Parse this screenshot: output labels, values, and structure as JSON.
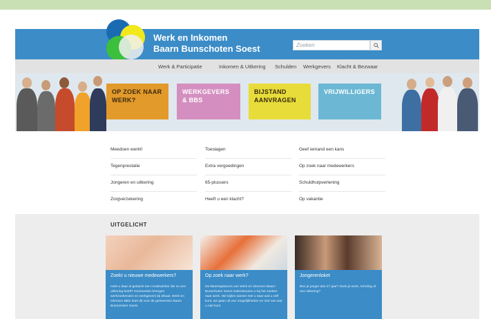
{
  "brand": {
    "line1": "Werk en Inkomen",
    "line2": "Baarn Bunschoten Soest"
  },
  "search": {
    "placeholder": "Zoeken",
    "icon": "magnifier-icon"
  },
  "nav": [
    "Werk & Participatie",
    "Inkomen & Uitkering",
    "Schulden",
    "Werkgevers",
    "Klacht & Bezwaar"
  ],
  "tiles": [
    {
      "label": "OP ZOEK NAAR WERK?",
      "color": "#e29a2a"
    },
    {
      "label": "WERKGEVERS & BBS",
      "color": "#d48fc0"
    },
    {
      "label": "BIJSTAND AANVRAGEN",
      "color": "#e8dc3a"
    },
    {
      "label": "VRIJWILLIGERS",
      "color": "#6cb8d4"
    }
  ],
  "links": [
    [
      "Meedoen werkt!",
      "Toeslagen",
      "Geef iemand een kans"
    ],
    [
      "Tegenprestatie",
      "Extra vergoedingen",
      "Op zoek naar medewerkers"
    ],
    [
      "Jongeren en uitkering",
      "65-plussers",
      "Schuldhulpverlening"
    ],
    [
      "Zorgverzekering",
      "Heeft u een klacht?",
      "Op vakantie"
    ]
  ],
  "uitgelicht": {
    "title": "UITGELICHT",
    "cards": [
      {
        "title": "Zoekt u nieuwe medewerkers?",
        "text": "Hebt u daar al gedacht een medewerker die nu een uitkering heeft? Gemeenten brengen werkzoekenden en werkgevers bij elkaar. Werk en Inkomen BBS doet dit voor de gemeenten Baarn Bunschoten Soest."
      },
      {
        "title": "Op zoek naar werk?",
        "text": "De klantregisseurs van Werk en Inkomen Baarn Bunschoten Soest ondersteunen u bij het zoeken naar werk. We kijken samen met u naar wat u zelf kunt, we gaan uit van mogelijkheden en niet van wat u niet kunt."
      },
      {
        "title": "Jongerenloket",
        "text": "Ben je jonger dan 27 jaar? Zoek je werk, scholing of een uitkering?"
      }
    ]
  }
}
